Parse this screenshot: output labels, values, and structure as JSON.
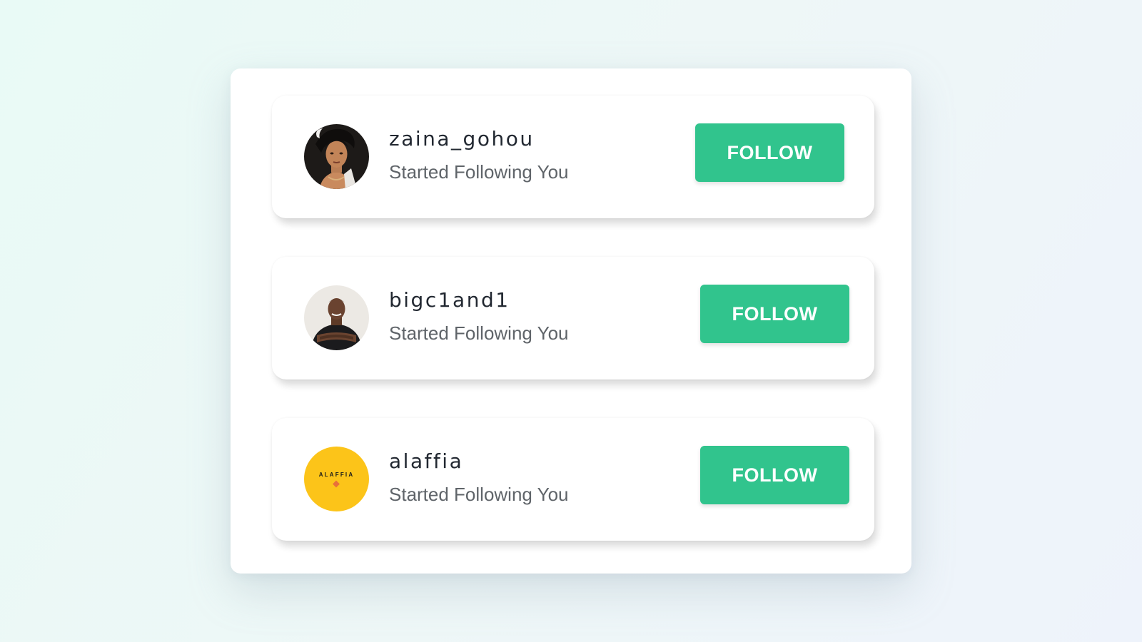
{
  "notifications": [
    {
      "username": "zaina_gohou",
      "subtitle": "Started Following You",
      "button_label": "FOLLOW",
      "avatar_icon": "user-photo-woman"
    },
    {
      "username": "bigc1and1",
      "subtitle": "Started Following You",
      "button_label": "FOLLOW",
      "avatar_icon": "user-photo-man"
    },
    {
      "username": "alaffia",
      "subtitle": "Started Following You",
      "button_label": "FOLLOW",
      "avatar_icon": "brand-logo",
      "avatar_logo_text": "ALAFFIA"
    }
  ],
  "colors": {
    "button": "#31c48d",
    "button_text": "#ffffff",
    "username": "#222831",
    "subtitle": "#5f6469",
    "logo_background": "#fcc419"
  }
}
